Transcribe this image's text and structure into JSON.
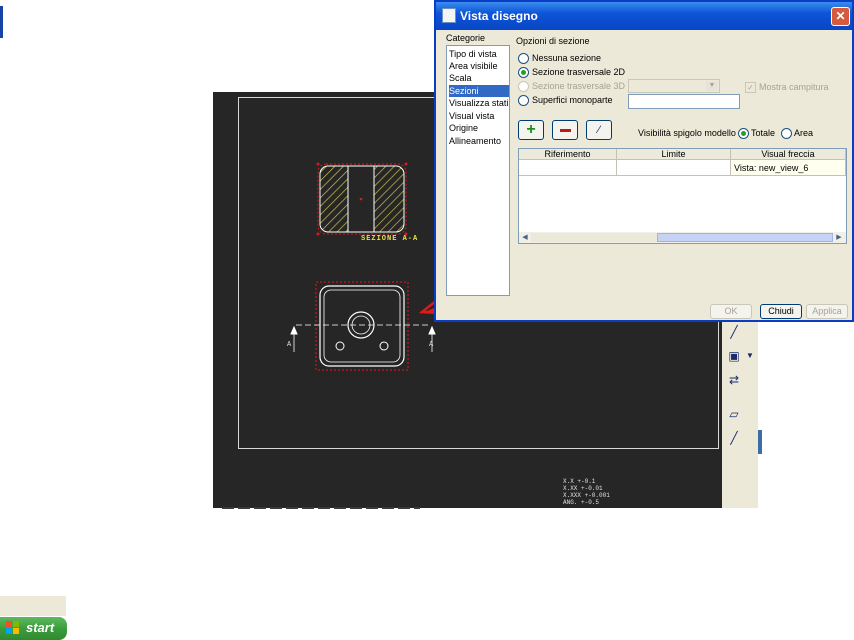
{
  "dialog": {
    "title": "Vista disegno",
    "categories_label": "Categorie",
    "categories": [
      "Tipo di vista",
      "Area visibile",
      "Scala",
      "Sezioni",
      "Visualizza stati",
      "Visual vista",
      "Origine",
      "Allineamento"
    ],
    "selected_category": "Sezioni",
    "section_options_label": "Opzioni di sezione",
    "radio_none": "Nessuna sezione",
    "radio_2d": "Sezione trasversale 2D",
    "radio_3d": "Sezione trasversale 3D",
    "radio_mono": "Superfici monoparte",
    "hatch_checkbox": "Mostra campitura",
    "visibility_label": "Visibilità spigolo modello",
    "visibility_total": "Totale",
    "visibility_area": "Area",
    "table": {
      "headers": [
        "Riferimento",
        "Limite",
        "Visual freccia"
      ],
      "rows": [
        [
          "",
          "",
          "Vista: new_view_6"
        ]
      ]
    },
    "ok_label": "OK",
    "close_label": "Chiudi",
    "apply_label": "Applica"
  },
  "drawing": {
    "section_label": "SEZIONE A-A",
    "arrow_label_left": "A",
    "arrow_label_right": "A",
    "tolerances": [
      "X.X   +-0.1",
      "X.XX  +-0.01",
      "X.XXX +-0.001",
      "ANG.  +-0.5"
    ]
  },
  "taskbar": {
    "start_label": "start"
  },
  "colors": {
    "dialog_title": "#0d55d8",
    "canvas_bg": "#262626",
    "annotation_red": "#e01818",
    "selection": "#316ac5",
    "hatch": "#c8c050"
  }
}
